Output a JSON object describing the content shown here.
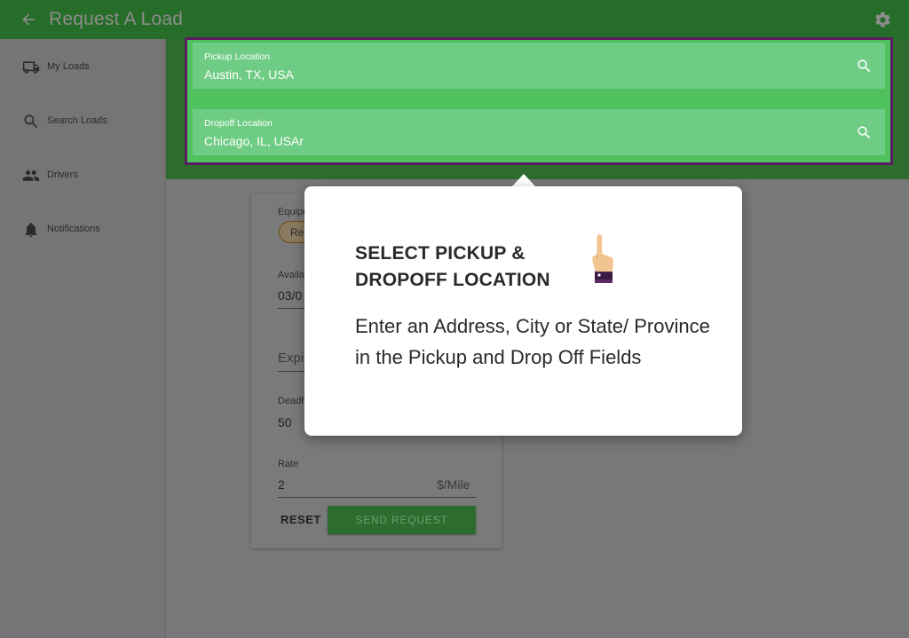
{
  "header": {
    "title": "Request A Load"
  },
  "sidebar": {
    "items": [
      {
        "label": "My Loads",
        "icon": "truck-icon"
      },
      {
        "label": "Search Loads",
        "icon": "search-icon"
      },
      {
        "label": "Drivers",
        "icon": "people-icon"
      },
      {
        "label": "Notifications",
        "icon": "bell-icon"
      }
    ]
  },
  "location": {
    "pickup": {
      "label": "Pickup Location",
      "value": "Austin, TX, USA"
    },
    "dropoff": {
      "label": "Dropoff Location",
      "value": "Chicago, IL, USAr"
    }
  },
  "form": {
    "equipment_label": "Equipm",
    "equipment_chip": "Re",
    "available_label": "Availa",
    "available_value": "03/0",
    "expires_placeholder": "Expir",
    "deadhead_label": "Deadh",
    "deadhead_value": "50",
    "rate_label": "Rate",
    "rate_value": "2",
    "rate_unit": "$/Mile",
    "reset_label": "RESET",
    "send_label": "SEND REQUEST"
  },
  "tooltip": {
    "heading": "SELECT PICKUP & DROPOFF LOCATION",
    "body": "Enter an Address, City or State/ Province in the Pickup and Drop Off Fields"
  },
  "colors": {
    "app_bar": "#276d2a",
    "field_green": "#6fcc84",
    "highlight_border": "#5a1d62",
    "overlay_gray": "#787878"
  }
}
